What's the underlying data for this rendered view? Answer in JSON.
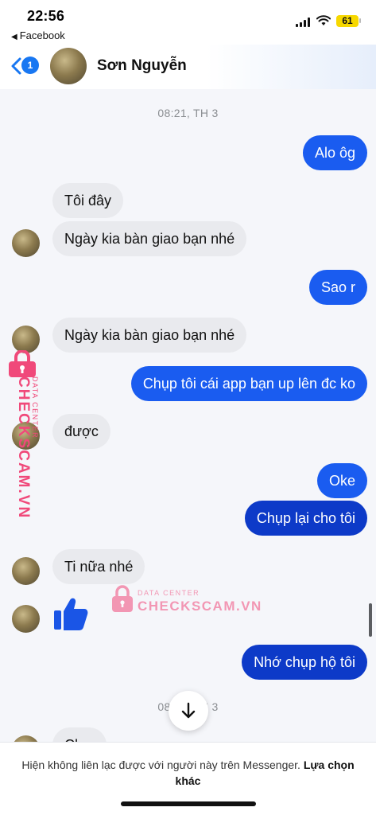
{
  "status_bar": {
    "time": "22:56",
    "back_app": "Facebook",
    "battery": "61"
  },
  "header": {
    "unread_count": "1",
    "contact_name": "Sơn Nguyễn"
  },
  "chat": {
    "timestamp_1": "08:21, TH 3",
    "timestamp_2": "08:21, TH 3",
    "messages": [
      {
        "side": "out",
        "text": "Alo ôg"
      },
      {
        "side": "in",
        "text": "Tôi đây"
      },
      {
        "side": "in",
        "text": "Ngày kia bàn giao bạn nhé"
      },
      {
        "side": "out",
        "text": "Sao r"
      },
      {
        "side": "in",
        "text": "Ngày kia bàn giao bạn nhé"
      },
      {
        "side": "out",
        "text": "Chụp tôi cái app bạn up lên đc ko"
      },
      {
        "side": "in",
        "text": "được"
      },
      {
        "side": "out",
        "text": "Oke"
      },
      {
        "side": "out",
        "text": "Chụp lại cho tôi"
      },
      {
        "side": "in",
        "text": "Ti nữa nhé"
      },
      {
        "side": "in",
        "type": "like",
        "icon": "thumbs-up-icon"
      },
      {
        "side": "out",
        "text": "Nhớ chụp hộ tôi"
      },
      {
        "side": "in",
        "text": "Ch..."
      }
    ]
  },
  "watermark": {
    "brand": "CHECKSCAM.VN",
    "sub": "DATA CENTER",
    "color": "#f0497a"
  },
  "footer": {
    "notice": "Hiện không liên lạc được với người này trên Messenger.",
    "other_choice": "Lựa chọn khác"
  },
  "colors": {
    "outgoing_bubble": "#1a5cf0",
    "outgoing_bubble_dark": "#0d3ac8",
    "incoming_bubble": "#e9eaee",
    "accent": "#1877f2"
  }
}
